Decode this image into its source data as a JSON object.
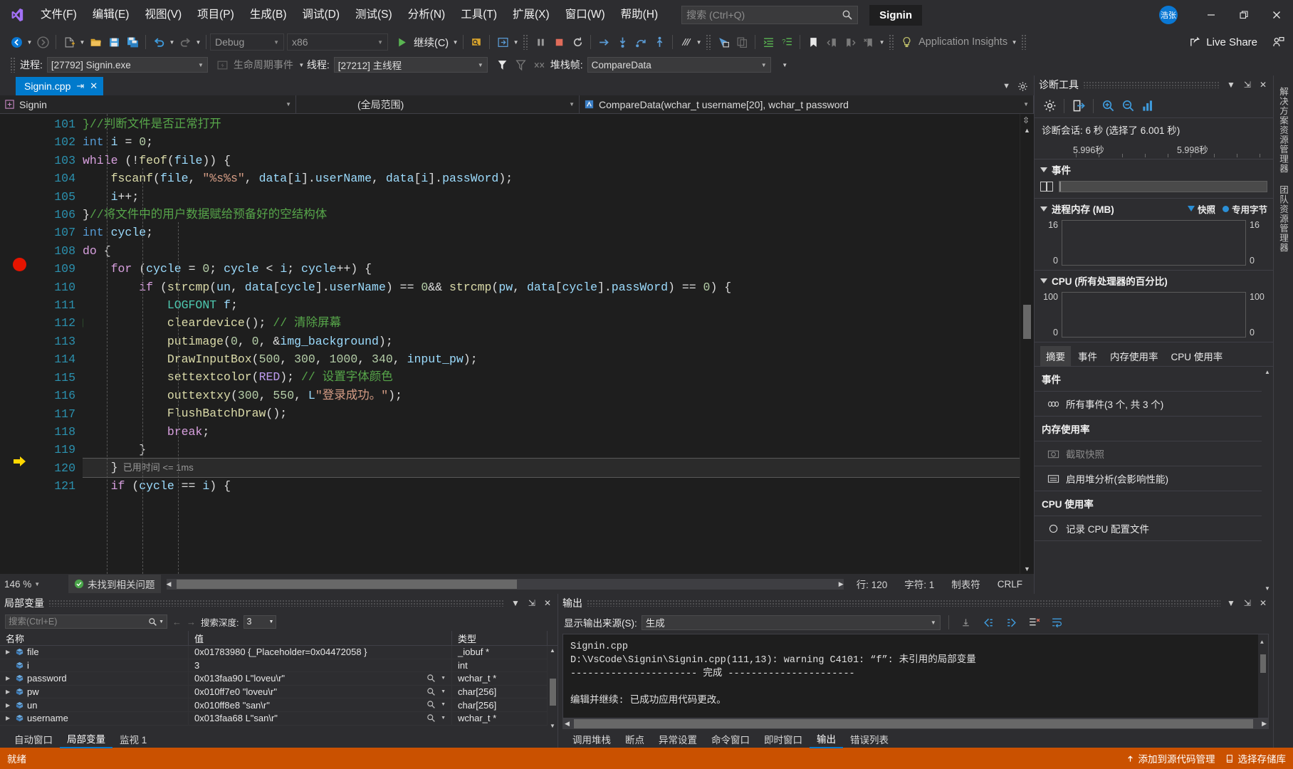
{
  "window": {
    "title": "Signin",
    "avatar_initials": "浩张",
    "minimize": "—",
    "restore": "❐",
    "close": "✕"
  },
  "menu": {
    "items": [
      {
        "label": "文件(F)",
        "name": "menu-file"
      },
      {
        "label": "编辑(E)",
        "name": "menu-edit"
      },
      {
        "label": "视图(V)",
        "name": "menu-view"
      },
      {
        "label": "项目(P)",
        "name": "menu-project"
      },
      {
        "label": "生成(B)",
        "name": "menu-build"
      },
      {
        "label": "调试(D)",
        "name": "menu-debug"
      },
      {
        "label": "测试(S)",
        "name": "menu-test"
      },
      {
        "label": "分析(N)",
        "name": "menu-analyze"
      },
      {
        "label": "工具(T)",
        "name": "menu-tools"
      },
      {
        "label": "扩展(X)",
        "name": "menu-extensions"
      },
      {
        "label": "窗口(W)",
        "name": "menu-window"
      },
      {
        "label": "帮助(H)",
        "name": "menu-help"
      }
    ]
  },
  "search": {
    "placeholder": "搜索 (Ctrl+Q)",
    "value": ""
  },
  "toolbar": {
    "configuration": "Debug",
    "platform": "x86",
    "continue_label": "继续(C)",
    "app_insights": "Application Insights",
    "live_share": "Live Share"
  },
  "debugbar": {
    "process_label": "进程:",
    "process_value": "[27792] Signin.exe",
    "lifecycle_label": "生命周期事件",
    "thread_label": "线程:",
    "thread_value": "[27212] 主线程",
    "stackframe_label": "堆栈帧:",
    "stackframe_value": "CompareData"
  },
  "editor": {
    "tab_name": "Signin.cpp",
    "nav_project": "Signin",
    "nav_scope": "(全局范围)",
    "nav_member": "CompareData(wchar_t username[20], wchar_t password",
    "zoom": "146 %",
    "issues": "未找到相关问题",
    "line_status": "行: 120",
    "char_status": "字符: 1",
    "tab_status": "制表符",
    "eol_status": "CRLF",
    "elapsed": "已用时间 <= 1ms",
    "first_line": 101,
    "lines": [
      {
        "n": 101,
        "html": "<span class='cmt'>}//判断文件是否正常打开</span>"
      },
      {
        "n": 102,
        "html": "<span class='kw2'>int</span> <span class='var'>i</span> <span class='pun'>= </span><span class='num'>0</span><span class='pun'>;</span>"
      },
      {
        "n": 103,
        "html": "<span class='kw'>while</span> <span class='pun'>(!</span><span class='fn'>feof</span><span class='pun'>(</span><span class='var'>file</span><span class='pun'>)) {</span>"
      },
      {
        "n": 104,
        "html": "    <span class='fn'>fscanf</span><span class='pun'>(</span><span class='var'>file</span><span class='pun'>, </span><span class='str'>\"%s%s\"</span><span class='pun'>, </span><span class='var'>data</span><span class='pun'>[</span><span class='var'>i</span><span class='pun'>].</span><span class='var'>userName</span><span class='pun'>, </span><span class='var'>data</span><span class='pun'>[</span><span class='var'>i</span><span class='pun'>].</span><span class='var'>passWord</span><span class='pun'>);</span>"
      },
      {
        "n": 105,
        "html": "    <span class='var'>i</span><span class='pun'>++;</span>"
      },
      {
        "n": 106,
        "html": "<span class='pun'>}</span><span class='cmt'>//将文件中的用户数据赋给预备好的空结构体</span>"
      },
      {
        "n": 107,
        "html": "<span class='kw2'>int</span> <span class='var'>cycle</span><span class='pun'>;</span>"
      },
      {
        "n": 108,
        "html": "<span class='kw'>do</span> <span class='pun'>{</span>"
      },
      {
        "n": 109,
        "html": "    <span class='kw'>for</span> <span class='pun'>(</span><span class='var'>cycle</span> <span class='pun'>= </span><span class='num'>0</span><span class='pun'>; </span><span class='var'>cycle</span> <span class='pun'>&lt; </span><span class='var'>i</span><span class='pun'>; </span><span class='var'>cycle</span><span class='pun'>++) {</span>"
      },
      {
        "n": 110,
        "html": "        <span class='kw'>if</span> <span class='pun'>(</span><span class='fn'>strcmp</span><span class='pun'>(</span><span class='var'>un</span><span class='pun'>, </span><span class='var'>data</span><span class='pun'>[</span><span class='var'>cycle</span><span class='pun'>].</span><span class='var'>userName</span><span class='pun'>) == </span><span class='num'>0</span><span class='pun'>&amp;&amp; </span><span class='fn'>strcmp</span><span class='pun'>(</span><span class='var'>pw</span><span class='pun'>, </span><span class='var'>data</span><span class='pun'>[</span><span class='var'>cycle</span><span class='pun'>].</span><span class='var'>passWord</span><span class='pun'>) == </span><span class='num'>0</span><span class='pun'>) {</span>"
      },
      {
        "n": 111,
        "html": "            <span class='typ'>LOGFONT</span> <span class='var'>f</span><span class='pun'>;</span>"
      },
      {
        "n": 112,
        "html": "            <span class='fn'>cleardevice</span><span class='pun'>(); </span><span class='cmt'>// 清除屏幕</span>"
      },
      {
        "n": 113,
        "html": "            <span class='fn'>putimage</span><span class='pun'>(</span><span class='num'>0</span><span class='pun'>, </span><span class='num'>0</span><span class='pun'>, &amp;</span><span class='var'>img_background</span><span class='pun'>);</span>"
      },
      {
        "n": 114,
        "html": "            <span class='fn'>DrawInputBox</span><span class='pun'>(</span><span class='num'>500</span><span class='pun'>, </span><span class='num'>300</span><span class='pun'>, </span><span class='num'>1000</span><span class='pun'>, </span><span class='num'>340</span><span class='pun'>, </span><span class='var'>input_pw</span><span class='pun'>);</span>"
      },
      {
        "n": 115,
        "html": "            <span class='fn'>settextcolor</span><span class='pun'>(</span><span class='mac'>RED</span><span class='pun'>); </span><span class='cmt'>// 设置字体颜色</span>"
      },
      {
        "n": 116,
        "html": "            <span class='fn'>outtextxy</span><span class='pun'>(</span><span class='num'>300</span><span class='pun'>, </span><span class='num'>550</span><span class='pun'>, </span><span class='var'>L</span><span class='str'>\"登录成功。\"</span><span class='pun'>);</span>"
      },
      {
        "n": 117,
        "html": "            <span class='fn'>FlushBatchDraw</span><span class='pun'>();</span>"
      },
      {
        "n": 118,
        "html": "            <span class='kw'>break</span><span class='pun'>;</span>"
      },
      {
        "n": 119,
        "html": "        <span class='pun'>}</span>"
      },
      {
        "n": 120,
        "html": "    <span class='pun'>}</span>"
      },
      {
        "n": 121,
        "html": "    <span class='kw'>if</span> <span class='pun'>(</span><span class='var'>cycle</span> <span class='pun'>== </span><span class='var'>i</span><span class='pun'>) {</span>"
      }
    ]
  },
  "diagnostics": {
    "title": "诊断工具",
    "session_text": "诊断会话: 6 秒 (选择了 6.001 秒)",
    "ruler_start": "5.996秒",
    "ruler_end": "5.998秒",
    "events_title": "事件",
    "memory_title": "进程内存 (MB)",
    "memory_max": "16",
    "memory_min": "0",
    "legend_snapshot": "快照",
    "legend_private": "专用字节",
    "cpu_title": "CPU (所有处理器的百分比)",
    "cpu_max": "100",
    "cpu_min": "0",
    "tabs": [
      {
        "label": "摘要",
        "active": true
      },
      {
        "label": "事件",
        "active": false
      },
      {
        "label": "内存使用率",
        "active": false
      },
      {
        "label": "CPU 使用率",
        "active": false
      }
    ],
    "sections": [
      {
        "title": "事件",
        "rows": [
          {
            "label": "所有事件(3 个, 共 3 个)",
            "icon": "events-icon",
            "dim": false
          }
        ]
      },
      {
        "title": "内存使用率",
        "rows": [
          {
            "label": "截取快照",
            "icon": "camera-icon",
            "dim": true
          },
          {
            "label": "启用堆分析(会影响性能)",
            "icon": "heap-icon",
            "dim": false
          }
        ]
      },
      {
        "title": "CPU 使用率",
        "rows": [
          {
            "label": "记录 CPU 配置文件",
            "icon": "record-icon",
            "dim": false
          }
        ]
      }
    ]
  },
  "locals": {
    "title": "局部变量",
    "search_placeholder": "搜索(Ctrl+E)",
    "depth_label": "搜索深度:",
    "depth_value": "3",
    "columns": [
      "名称",
      "值",
      "类型"
    ],
    "rows": [
      {
        "name": "file",
        "value": "0x01783980 {_Placeholder=0x04472058 }",
        "type": "_iobuf *",
        "expandable": true,
        "magnifier": false
      },
      {
        "name": "i",
        "value": "3",
        "type": "int",
        "expandable": false,
        "magnifier": false
      },
      {
        "name": "password",
        "value": "0x013faa90 L\"loveu\\r\"",
        "type": "wchar_t *",
        "expandable": true,
        "magnifier": true
      },
      {
        "name": "pw",
        "value": "0x010ff7e0 \"loveu\\r\"",
        "type": "char[256]",
        "expandable": true,
        "magnifier": true
      },
      {
        "name": "un",
        "value": "0x010ff8e8 \"san\\r\"",
        "type": "char[256]",
        "expandable": true,
        "magnifier": true
      },
      {
        "name": "username",
        "value": "0x013faa68 L\"san\\r\"",
        "type": "wchar_t *",
        "expandable": true,
        "magnifier": true
      }
    ],
    "tabs": [
      {
        "label": "自动窗口",
        "active": false
      },
      {
        "label": "局部变量",
        "active": true
      },
      {
        "label": "监视 1",
        "active": false
      }
    ]
  },
  "output": {
    "title": "输出",
    "source_label": "显示输出来源(S):",
    "source_value": "生成",
    "text": "Signin.cpp\nD:\\VsCode\\Signin\\Signin.cpp(111,13): warning C4101: “f”: 未引用的局部变量\n---------------------- 完成 ----------------------\n\n编辑并继续: 已成功应用代码更改。",
    "tabs": [
      {
        "label": "调用堆栈",
        "active": false
      },
      {
        "label": "断点",
        "active": false
      },
      {
        "label": "异常设置",
        "active": false
      },
      {
        "label": "命令窗口",
        "active": false
      },
      {
        "label": "即时窗口",
        "active": false
      },
      {
        "label": "输出",
        "active": true
      },
      {
        "label": "错误列表",
        "active": false
      }
    ]
  },
  "statusbar": {
    "ready": "就绪",
    "add_to_source_control": "添加到源代码管理",
    "repository": "选择存储库"
  },
  "right_rail": {
    "items": [
      "解决方案资源管理器",
      "团队资源管理器"
    ]
  },
  "colors": {
    "accent": "#007acc",
    "status_orange": "#ca5100",
    "breakpoint_red": "#e51400",
    "current_line_yellow": "#ffd700",
    "editor_bg": "#1e1e1e",
    "chrome_bg": "#2d2d30"
  }
}
